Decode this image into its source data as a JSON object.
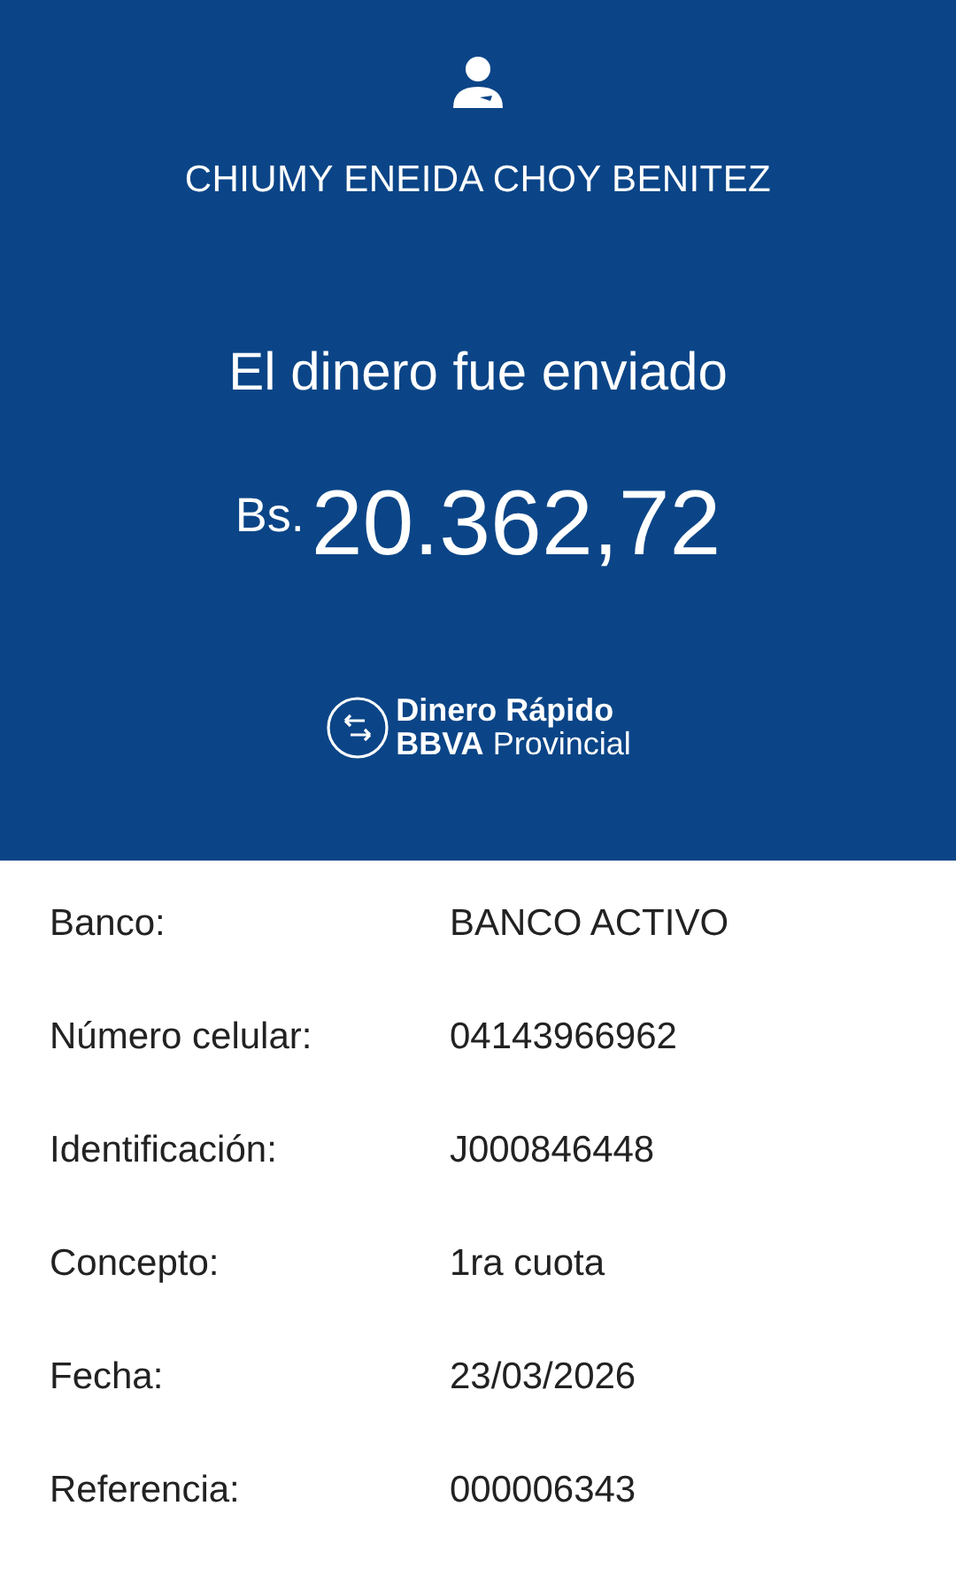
{
  "header": {
    "recipient": "CHIUMY ENEIDA CHOY BENITEZ",
    "message": "El dinero fue enviado",
    "currency": "Bs.",
    "amount": "20.362,72",
    "logo": {
      "line1": "Dinero Rápido",
      "line2": "**BBVA** Provincial"
    }
  },
  "details": [
    {
      "label": "Banco:",
      "value": "BANCO ACTIVO"
    },
    {
      "label": "Número celular:",
      "value": "04143966962"
    },
    {
      "label": "Identificación:",
      "value": "J000846448"
    },
    {
      "label": "Concepto:",
      "value": "1ra cuota"
    },
    {
      "label": "Fecha:",
      "value": "23/03/2026"
    },
    {
      "label": "Referencia:",
      "value": "000006343"
    }
  ]
}
